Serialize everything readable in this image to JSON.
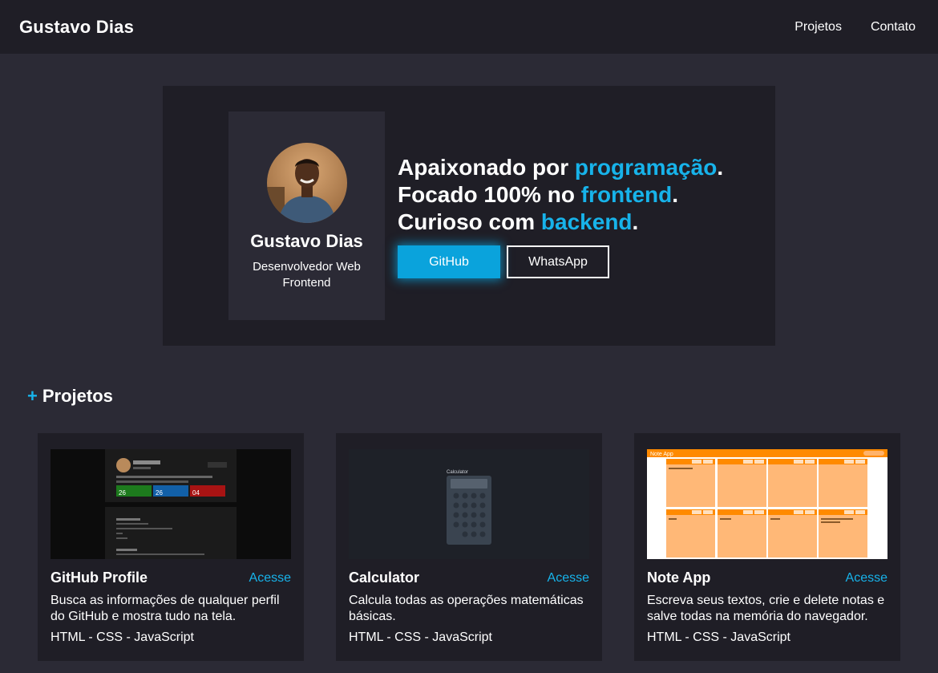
{
  "header": {
    "brand": "Gustavo Dias",
    "nav": [
      "Projetos",
      "Contato"
    ]
  },
  "hero": {
    "profile": {
      "name": "Gustavo Dias",
      "role": "Desenvolvedor Web Frontend"
    },
    "lines": [
      {
        "prefix": "Apaixonado por ",
        "highlight": "programação",
        "suffix": "."
      },
      {
        "prefix": "Focado 100% no ",
        "highlight": "frontend",
        "suffix": "."
      },
      {
        "prefix": "Curioso com ",
        "highlight": "backend",
        "suffix": "."
      }
    ],
    "buttons": {
      "github": "GitHub",
      "whatsapp": "WhatsApp"
    }
  },
  "projects": {
    "plus": "+",
    "title": "Projetos",
    "items": [
      {
        "title": "GitHub Profile",
        "link": "Acesse",
        "description": "Busca as informações de qualquer perfil do GitHub e mostra tudo na tela.",
        "tech": "HTML - CSS - JavaScript"
      },
      {
        "title": "Calculator",
        "link": "Acesse",
        "description": "Calcula todas as operações matemáticas básicas.",
        "tech": "HTML - CSS - JavaScript"
      },
      {
        "title": "Note App",
        "link": "Acesse",
        "description": "Escreva seus textos, crie e delete notas e salve todas na memória do navegador.",
        "tech": "HTML - CSS - JavaScript"
      }
    ]
  },
  "thumbnails": {
    "github_profile": {
      "stats": [
        "26",
        "26",
        "04"
      ]
    },
    "calculator": {
      "title": "Calculator"
    },
    "note_app": {
      "title": "Note App"
    }
  },
  "colors": {
    "accent": "#17b3ea",
    "background": "#2b2a35",
    "panel": "#1f1e26",
    "note_orange": "#ff8a00"
  }
}
